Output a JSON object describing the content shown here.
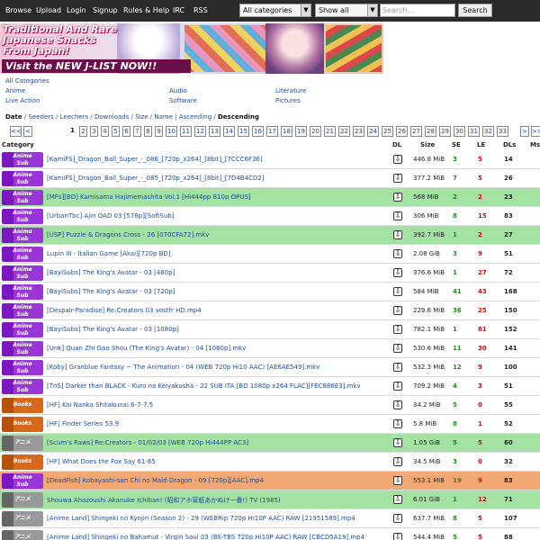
{
  "nav": {
    "browse": "Browse",
    "upload": "Upload",
    "login": "Login",
    "signup": "Signup",
    "rules": "Rules & Help",
    "irc": "IRC",
    "rss": "RSS"
  },
  "filters": {
    "category": "All categories",
    "status": "Show all",
    "search_placeholder": "Search...",
    "search_button": "Search"
  },
  "banner": {
    "line1": "Traditional And Rare",
    "line2": "Japanese Snacks",
    "line3": "From Japan!",
    "line4": "Visit the NEW J-LIST NOW!!"
  },
  "categories": {
    "all": "All Categories",
    "anime": "Anime",
    "audio": "Audio",
    "literature": "Literature",
    "live_action": "Live Action",
    "software": "Software",
    "pictures": "Pictures"
  },
  "sort": {
    "date": "Date",
    "seeders": "Seeders",
    "leechers": "Leechers",
    "downloads": "Downloads",
    "size": "Size",
    "name": "Name",
    "ascending": "Ascending",
    "descending": "Descending"
  },
  "pager": {
    "first": "<<",
    "prev": "<",
    "next": ">",
    "last": ">>",
    "pages": [
      "1",
      "2",
      "3",
      "4",
      "5",
      "6",
      "7",
      "8",
      "9",
      "10",
      "11",
      "12",
      "13",
      "14",
      "15",
      "16",
      "17",
      "18",
      "19",
      "20",
      "21",
      "22",
      "23",
      "24",
      "25",
      "26",
      "27",
      "28",
      "29",
      "30",
      "31",
      "32",
      "33"
    ],
    "current": "1"
  },
  "columns": {
    "category": "Category",
    "dl": "DL",
    "size": "Size",
    "se": "SE",
    "le": "LE",
    "dls": "DLs",
    "msg": "Msg"
  },
  "badges": {
    "anime": "Anime\nSub",
    "books": "Books",
    "raw": "アニメ"
  },
  "colors": {
    "trusted": "#a3e2a3",
    "remake": "#f2a872",
    "normal": "#ffffff"
  },
  "rows": [
    {
      "cat": "anime",
      "name": "[KamiFS]_Dragon_Ball_Super_-_086_[720p_x264]_[8bit]_[7CCC6F36]",
      "size": "446.8 MiB",
      "se": "3",
      "le": "5",
      "dls": "14",
      "status": "normal"
    },
    {
      "cat": "anime",
      "name": "[KamiFS]_Dragon_Ball_Super_-_085_[720p_x264]_[8bit]_[7D4B4CD2]",
      "size": "377.2 MiB",
      "se": "7",
      "le": "5",
      "dls": "26",
      "status": "normal"
    },
    {
      "cat": "anime",
      "name": "[MFs][BD] Kamisama Hajimemashita Vol.1 [Hi444pp 810p OPUS]",
      "size": "568 MiB",
      "se": "2",
      "le": "2",
      "dls": "23",
      "status": "trusted"
    },
    {
      "cat": "anime",
      "name": "[UrbanTbc] Ajin OAD 03 [576p][SoftSub]",
      "size": "306 MiB",
      "se": "8",
      "le": "15",
      "dls": "83",
      "status": "normal"
    },
    {
      "cat": "anime",
      "name": "[USP] Puzzle & Dragons Cross - 26 [070CFA72].mkv",
      "size": "392.7 MiB",
      "se": "1",
      "le": "2",
      "dls": "27",
      "status": "trusted"
    },
    {
      "cat": "anime",
      "name": "Lupin III - Italian Game [Akai][720p BD]",
      "size": "2.08 GiB",
      "se": "3",
      "le": "9",
      "dls": "51",
      "status": "normal"
    },
    {
      "cat": "anime",
      "name": "[BayiSubs] The King's Avatar - 03 [480p]",
      "size": "376.6 MiB",
      "se": "1",
      "le": "27",
      "dls": "72",
      "status": "normal"
    },
    {
      "cat": "anime",
      "name": "[BayiSubs] The King's Avatar - 03 [720p]",
      "size": "584 MiB",
      "se": "41",
      "le": "43",
      "dls": "168",
      "status": "normal"
    },
    {
      "cat": "anime",
      "name": "[Despair-Paradise] Re:Creators 03 vostfr HD.mp4",
      "size": "229.6 MiB",
      "se": "36",
      "le": "25",
      "dls": "150",
      "status": "normal"
    },
    {
      "cat": "anime",
      "name": "[BayiSubs] The King's Avatar - 03 [1080p]",
      "size": "782.1 MiB",
      "se": "1",
      "le": "81",
      "dls": "152",
      "status": "normal"
    },
    {
      "cat": "anime",
      "name": "[Unk] Quan Zhi Gao Shou (The King's Avatar) - 04 [1080p].mkv",
      "size": "530.6 MiB",
      "se": "11",
      "le": "30",
      "dls": "141",
      "status": "normal"
    },
    {
      "cat": "anime",
      "name": "[Koby] Granblue Fantasy ~ The Animation - 04 (WEB 720p Hi10 AAC) [AE6AE549].mkv",
      "size": "532.3 MiB",
      "se": "12",
      "le": "9",
      "dls": "100",
      "status": "normal"
    },
    {
      "cat": "anime",
      "name": "[TnS] Darker than BLACK - Kuro no Keiyakusha - 22 SUB ITA [BD 1080p x264 FLAC][FEC886E3].mkv",
      "size": "709.2 MiB",
      "se": "4",
      "le": "3",
      "dls": "51",
      "status": "normal"
    },
    {
      "cat": "books",
      "name": "[HF] Koi Nanka Shitakunai 6-7-7.5",
      "size": "34.2 MiB",
      "se": "5",
      "le": "0",
      "dls": "55",
      "status": "normal"
    },
    {
      "cat": "books",
      "name": "[HF] Finder Series 53.9",
      "size": "5.8 MiB",
      "se": "8",
      "le": "1",
      "dls": "52",
      "status": "normal"
    },
    {
      "cat": "raw",
      "name": "[Scum's Raws] Re:Creators - 01/02/03 [WEB 720p Hi444PP AC3]",
      "size": "1.05 GiB",
      "se": "5",
      "le": "5",
      "dls": "60",
      "status": "trusted"
    },
    {
      "cat": "books",
      "name": "[HF] What Does the Fox Say 61-65",
      "size": "34.5 MiB",
      "se": "3",
      "le": "0",
      "dls": "32",
      "status": "normal"
    },
    {
      "cat": "anime",
      "name": "[DeadFish] Kobayashi-san Chi no Maid Dragon - 09 [720p][AAC].mp4",
      "size": "553.1 MiB",
      "se": "19",
      "le": "9",
      "dls": "83",
      "status": "remake"
    },
    {
      "cat": "raw",
      "name": "Shouwa Ahozoushi Akanuke Ichiban! (昭和アホ草紙あかぬけ一番!) TV (1985)",
      "size": "6.01 GiB",
      "se": "1",
      "le": "12",
      "dls": "71",
      "status": "trusted"
    },
    {
      "cat": "raw",
      "name": "[Anime Land] Shingeki no Kyojin (Season 2) - 29 (WEBRip 720p Hi10P AAC) RAW [21951589].mp4",
      "size": "637.7 MiB",
      "se": "8",
      "le": "5",
      "dls": "107",
      "status": "normal"
    },
    {
      "cat": "raw",
      "name": "[Anime Land] Shingeki no Bahamut - Virgin Soul 03 (BS-TBS 720p Hi10P AAC) RAW [CBCD5A19].mp4",
      "size": "544.4 MiB",
      "se": "5",
      "le": "5",
      "dls": "88",
      "status": "normal"
    }
  ]
}
